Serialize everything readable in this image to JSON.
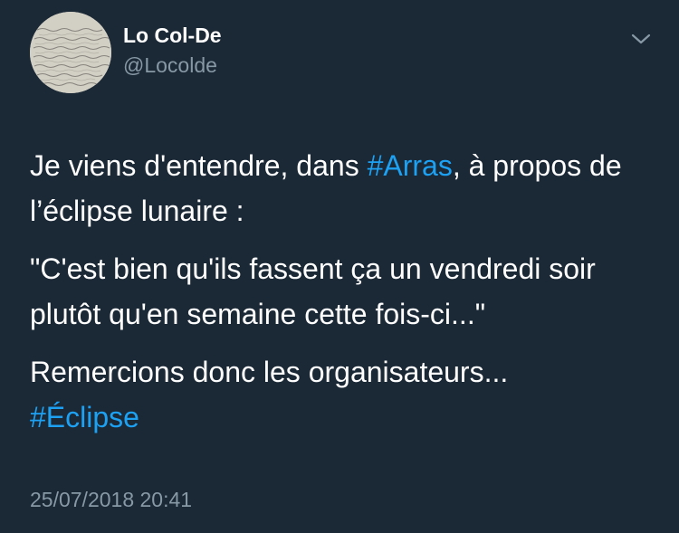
{
  "author": {
    "display_name": "Lo Col-De",
    "handle": "@Locolde",
    "avatar_icon": "handwritten-letter-avatar"
  },
  "menu": {
    "icon": "chevron-down-icon"
  },
  "tweet": {
    "line1_prefix": "Je viens d'entendre, dans ",
    "hashtag_arras": "#Arras",
    "line1_suffix": ", à propos de l’éclipse lunaire :",
    "quote": "\"C'est bien qu'ils fassent ça un vendredi soir plutôt qu'en semaine cette fois-ci...\"",
    "closing": "Remercions donc les organisateurs...",
    "hashtag_eclipse": "#Éclipse"
  },
  "timestamp": "25/07/2018 20:41",
  "colors": {
    "background": "#1b2836",
    "text": "#ffffff",
    "secondary": "#8899a6",
    "link": "#1da1f2"
  }
}
